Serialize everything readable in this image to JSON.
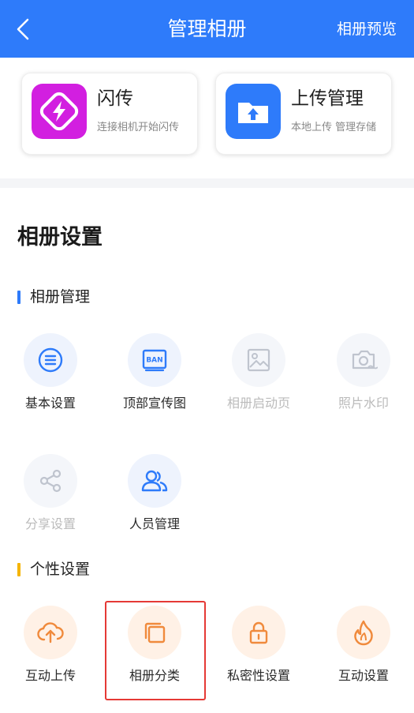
{
  "header": {
    "title": "管理相册",
    "preview_label": "相册预览",
    "background": "#2E7BFA"
  },
  "cards": [
    {
      "title": "闪传",
      "subtitle": "连接相机开始闪传",
      "icon": "lightning-icon",
      "color": "#D21FE0"
    },
    {
      "title": "上传管理",
      "subtitle": "本地上传 管理存储",
      "icon": "folder-upload-icon",
      "color": "#2E7BFA"
    }
  ],
  "section_title": "相册设置",
  "groups": [
    {
      "label": "相册管理",
      "bar_color": "#2E7BFA",
      "items": [
        {
          "label": "基本设置",
          "icon": "list-icon",
          "enabled": true
        },
        {
          "label": "顶部宣传图",
          "icon": "banner-icon",
          "enabled": true
        },
        {
          "label": "相册启动页",
          "icon": "image-icon",
          "enabled": false
        },
        {
          "label": "照片水印",
          "icon": "camera-icon",
          "enabled": false
        },
        {
          "label": "分享设置",
          "icon": "share-icon",
          "enabled": false
        },
        {
          "label": "人员管理",
          "icon": "people-icon",
          "enabled": true
        }
      ]
    },
    {
      "label": "个性设置",
      "bar_color": "#F5B400",
      "items": [
        {
          "label": "互动上传",
          "icon": "cloud-upload-icon",
          "enabled": true
        },
        {
          "label": "相册分类",
          "icon": "layers-icon",
          "enabled": true,
          "selected": true
        },
        {
          "label": "私密性设置",
          "icon": "lock-icon",
          "enabled": true
        },
        {
          "label": "互动设置",
          "icon": "flame-icon",
          "enabled": true
        }
      ]
    }
  ],
  "colors": {
    "accent_blue": "#2E7BFA",
    "accent_orange": "#F08A3C",
    "disabled": "#BBBBBB",
    "highlight": "#E53935"
  }
}
